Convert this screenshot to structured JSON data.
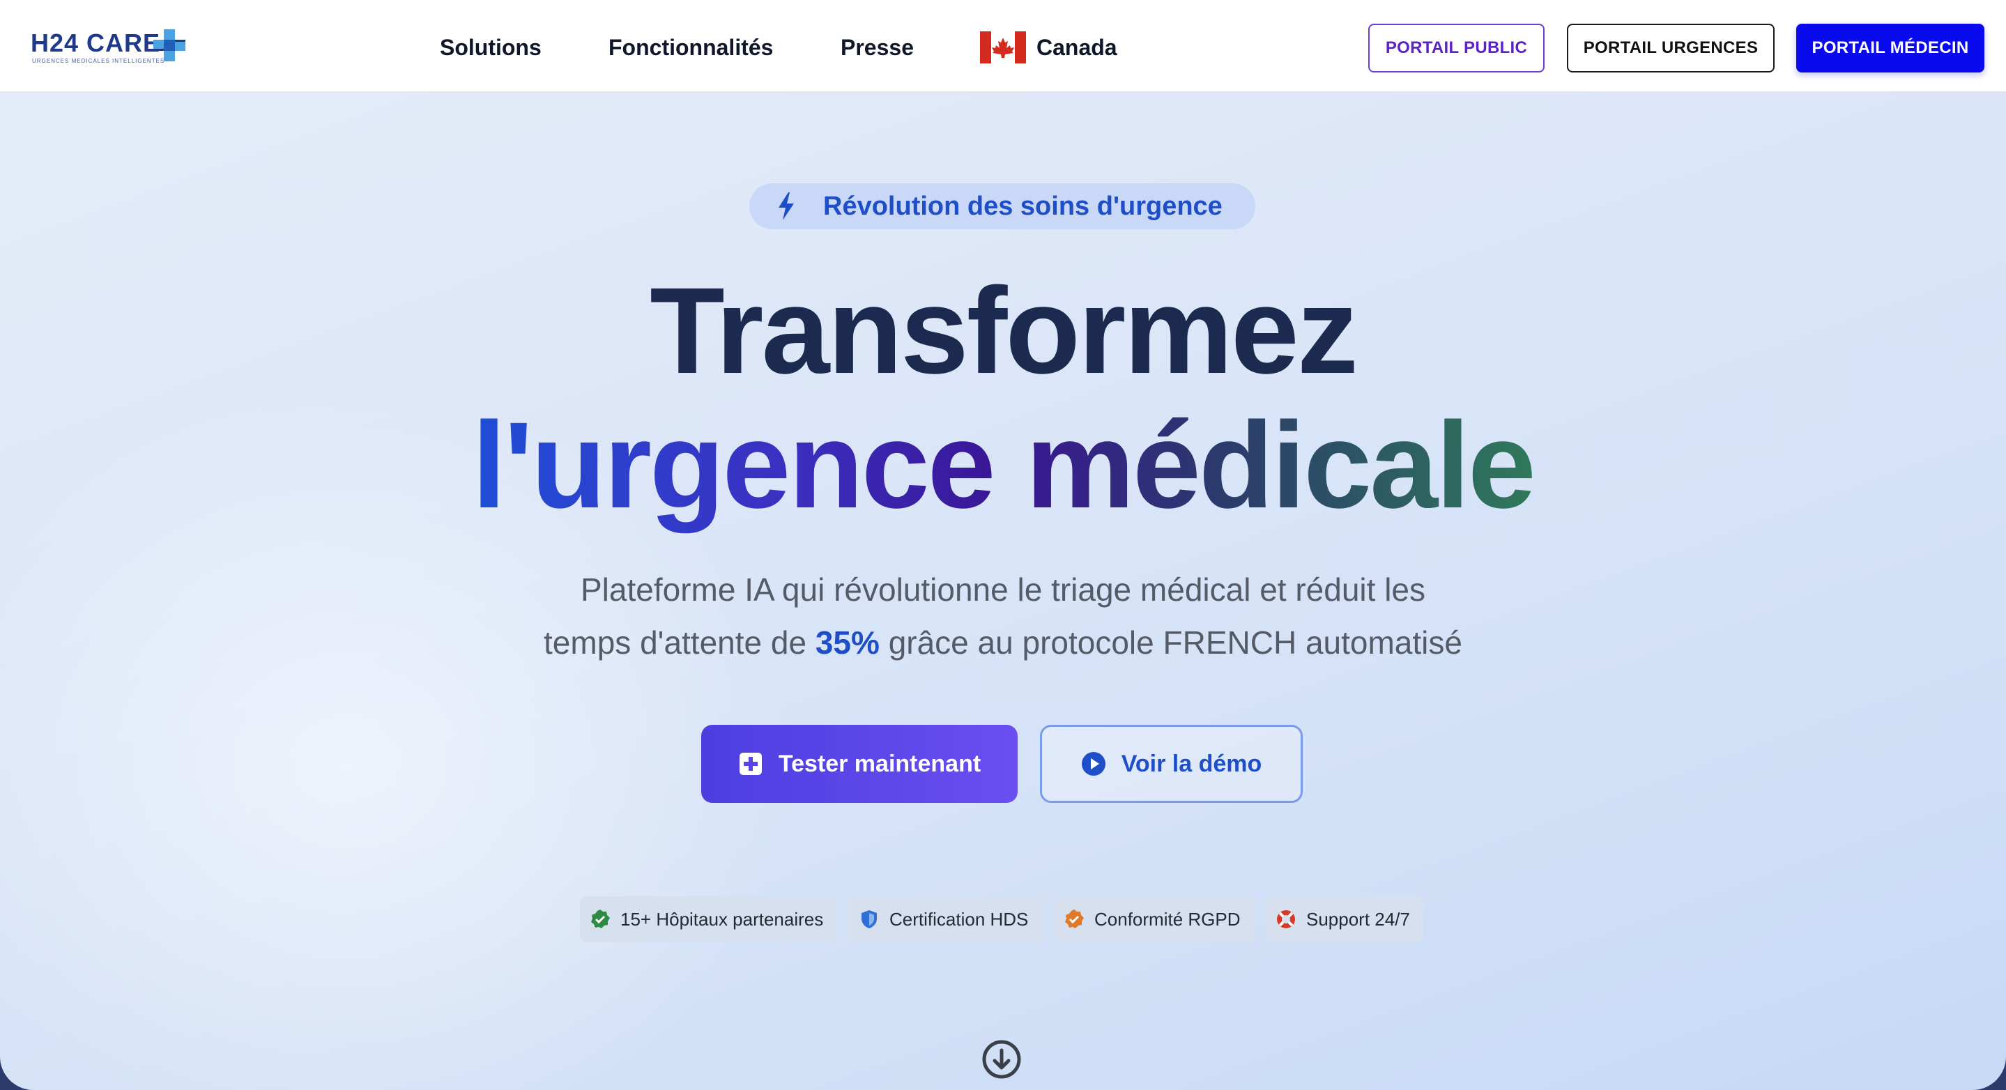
{
  "header": {
    "logo_text": "H24 CARE",
    "logo_tagline": "URGENCES MEDICALES INTELLIGENTES",
    "nav": [
      {
        "label": "Solutions"
      },
      {
        "label": "Fonctionnalités"
      },
      {
        "label": "Presse"
      },
      {
        "label": "Canada",
        "icon": "canada-flag-icon"
      }
    ],
    "buttons": {
      "public": "PORTAIL PUBLIC",
      "urgences": "PORTAIL URGENCES",
      "medecin": "PORTAIL MÉDECIN"
    }
  },
  "hero": {
    "badge": {
      "icon": "lightning-icon",
      "text": "Révolution des soins d'urgence"
    },
    "title_line1": "Transformez",
    "title_line2": "l'urgence médicale",
    "subtitle_part1": "Plateforme IA qui révolutionne le triage médical et réduit les",
    "subtitle_part2": "temps d'attente de ",
    "subtitle_highlight": "35%",
    "subtitle_part3": " grâce au protocole FRENCH automatisé",
    "cta_primary": {
      "label": "Tester maintenant",
      "icon": "plus-square-icon"
    },
    "cta_secondary": {
      "label": "Voir la démo",
      "icon": "play-circle-icon"
    }
  },
  "trust": [
    {
      "label": "15+ Hôpitaux partenaires",
      "icon": "check-badge-icon",
      "color": "#2e8b45"
    },
    {
      "label": "Certification HDS",
      "icon": "shield-icon",
      "color": "#2f6fd6"
    },
    {
      "label": "Conformité RGPD",
      "icon": "certificate-icon",
      "color": "#e07a2a"
    },
    {
      "label": "Support 24/7",
      "icon": "lifebuoy-icon",
      "color": "#d63a2a"
    }
  ],
  "colors": {
    "brand": "#1f3a8a",
    "accent": "#1f4fc8",
    "primary_button": "#0a0aee",
    "cta_gradient_start": "#4d3ee0",
    "cta_gradient_end": "#6a4ef0"
  }
}
